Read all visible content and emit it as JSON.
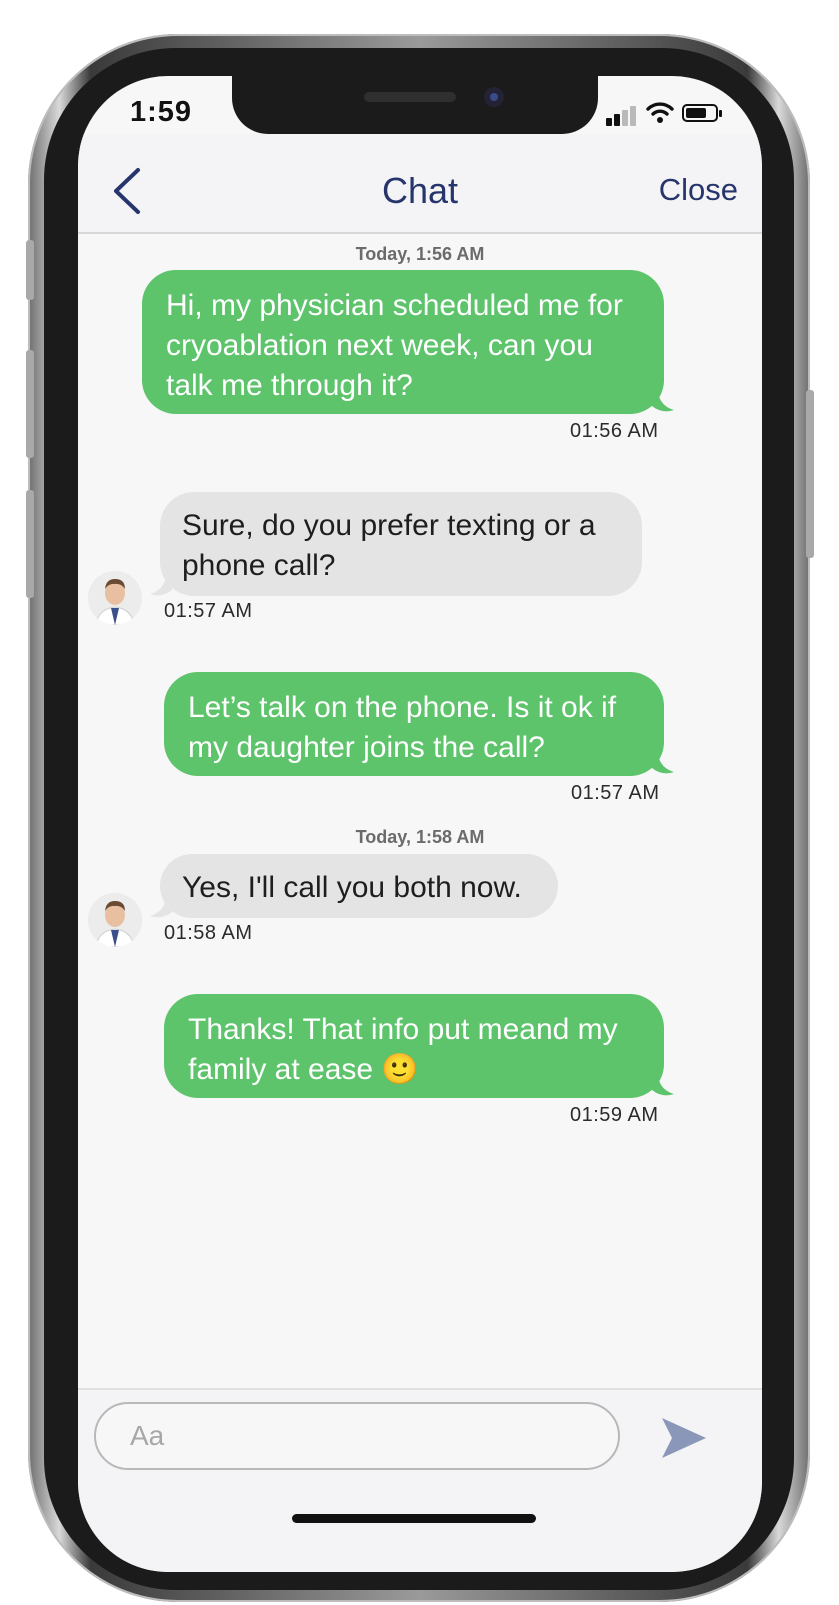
{
  "status_bar": {
    "time": "1:59"
  },
  "nav": {
    "title": "Chat",
    "close_label": "Close"
  },
  "messages": [
    {
      "divider": "Today, 1:56 AM",
      "direction": "out",
      "lines": [
        "Hi, my physician scheduled me for",
        "cryoablation next week, can you",
        "talk me through it?"
      ],
      "time": "01:56 AM"
    },
    {
      "direction": "in",
      "lines": [
        "Sure, do you prefer texting or a",
        "phone call?"
      ],
      "time": "01:57 AM"
    },
    {
      "direction": "out",
      "lines": [
        "Let’s talk on the phone. Is it ok if",
        "my daughter joins the call?"
      ],
      "time": "01:57 AM"
    },
    {
      "divider": "Today, 1:58 AM",
      "direction": "in",
      "lines": [
        "Yes, I'll call you both now."
      ],
      "time": "01:58 AM"
    },
    {
      "direction": "out",
      "lines": [
        "Thanks! That info put meand my",
        "family at ease 🙂"
      ],
      "time": "01:59 AM"
    }
  ],
  "composer": {
    "placeholder": "Aa"
  },
  "colors": {
    "outgoing_bubble": "#5dc46c",
    "incoming_bubble": "#e4e4e4",
    "nav_text": "#26356b",
    "send_icon": "#8a97b8"
  },
  "icons": {
    "back": "chevron-left-icon",
    "send": "send-arrow-icon"
  }
}
